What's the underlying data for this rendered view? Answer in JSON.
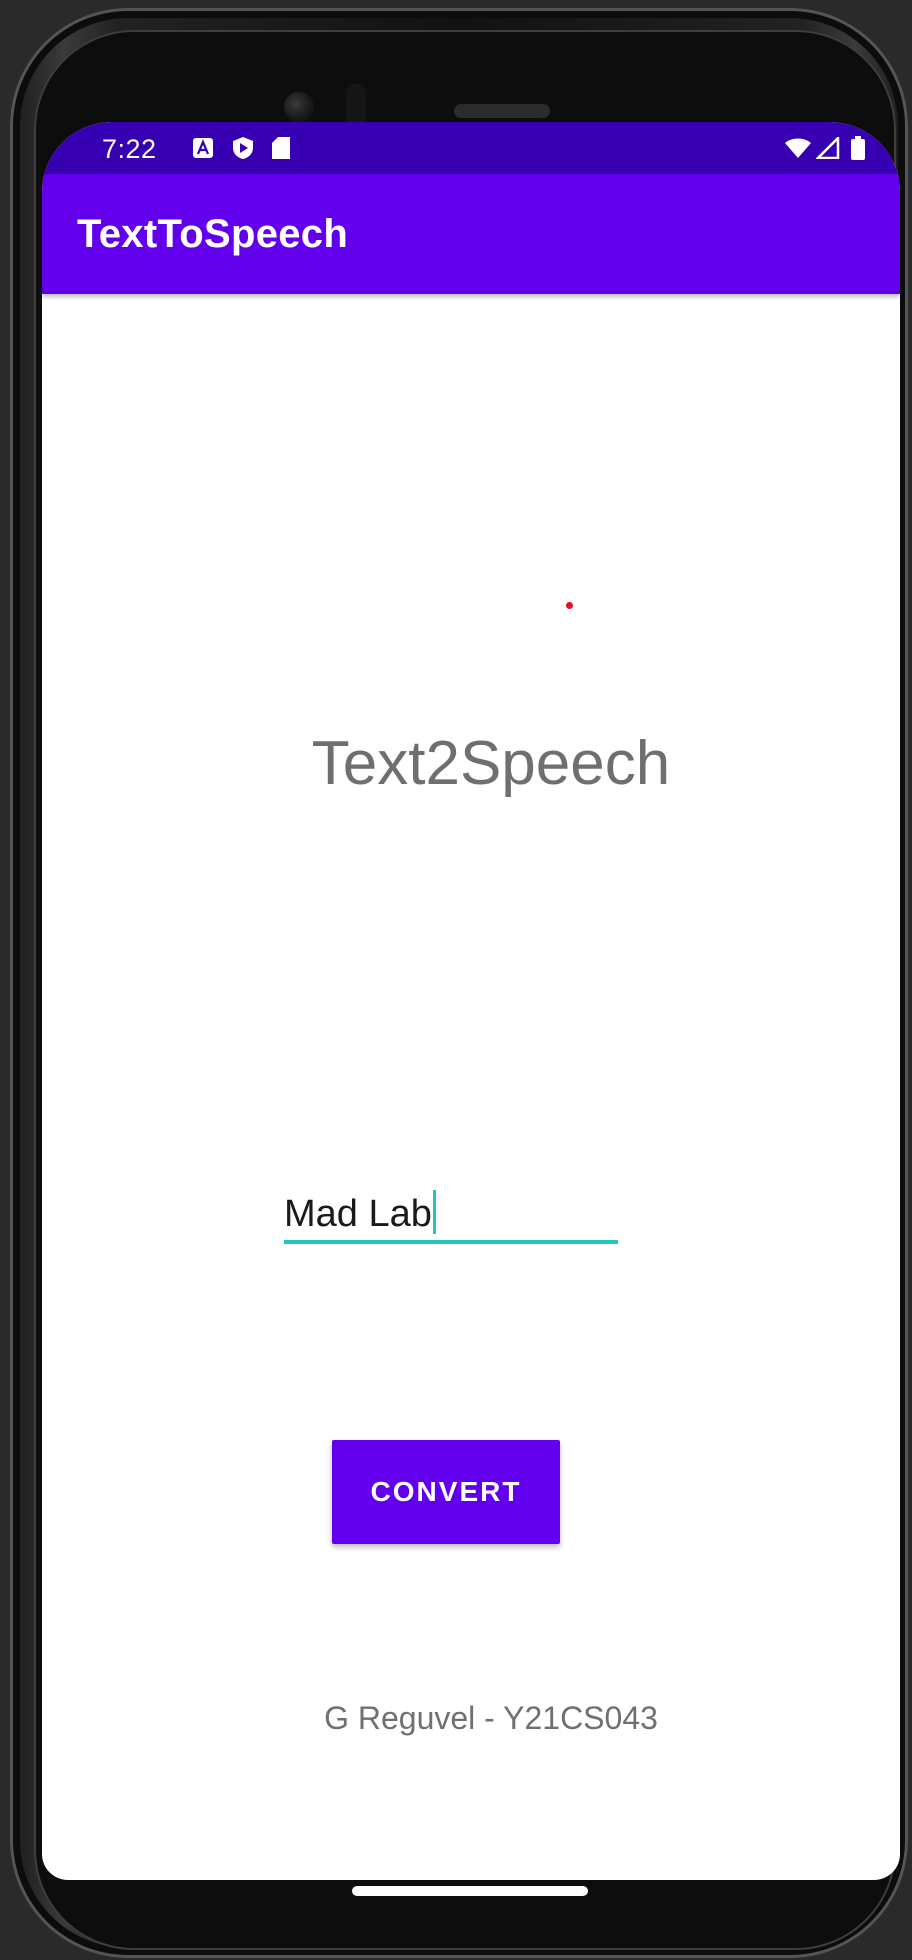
{
  "status_bar": {
    "time": "7:22",
    "left_icons": [
      "a-notification-icon",
      "shield-play-icon",
      "sd-card-icon"
    ],
    "right_icons": [
      "wifi-icon",
      "cellular-signal-icon",
      "battery-icon"
    ]
  },
  "app_bar": {
    "title": "TextToSpeech"
  },
  "main": {
    "heading": "Text2Speech",
    "input": {
      "value": "Mad Lab"
    },
    "convert_button": "CONVERT",
    "footer": "G Reguvel - Y21CS043"
  },
  "colors": {
    "status_bar": "#3700b3",
    "primary": "#6200ee",
    "accent": "#1fc7c0",
    "text_secondary": "#6f6f6f"
  }
}
